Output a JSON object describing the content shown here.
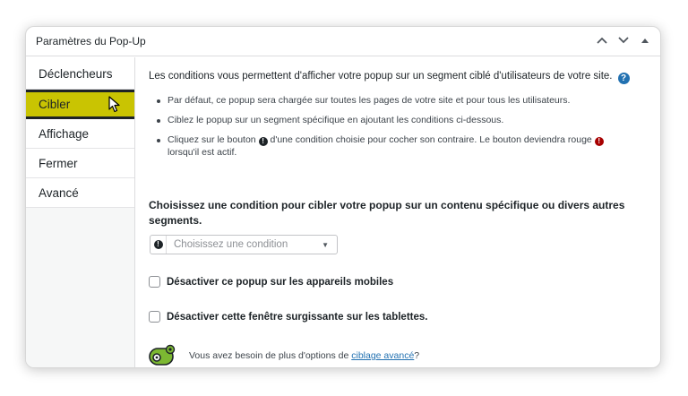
{
  "header": {
    "title": "Paramètres du Pop-Up"
  },
  "sidebar": {
    "items": [
      {
        "label": "Déclencheurs"
      },
      {
        "label": "Cibler"
      },
      {
        "label": "Affichage"
      },
      {
        "label": "Fermer"
      },
      {
        "label": "Avancé"
      }
    ],
    "active_index": 1
  },
  "main": {
    "intro": "Les conditions vous permettent d'afficher votre popup sur un segment ciblé d'utilisateurs de votre site.",
    "help_icon": "?",
    "bullets": {
      "b1": "Par défaut, ce popup sera chargée sur toutes les pages de votre site et pour tous les utilisateurs.",
      "b2": "Ciblez le popup sur un segment spécifique en ajoutant les conditions ci-dessous.",
      "b3_part1": "Cliquez sur le bouton",
      "b3_part2": "d'une condition choisie pour cocher son contraire. Le bouton deviendra rouge",
      "b3_part3": "lorsqu'il est actif."
    },
    "choose_title": "Choisissez une condition pour cibler votre popup sur un contenu spécifique ou divers autres segments.",
    "select_placeholder": "Choisissez une condition",
    "checkbox_mobile": "Désactiver ce popup sur les appareils mobiles",
    "checkbox_tablet": "Désactiver cette fenêtre surgissante sur les tablettes.",
    "advanced_prefix": "Vous avez besoin de plus d'options de",
    "advanced_link": "ciblage avancé",
    "advanced_suffix": " ?"
  },
  "icons": {
    "exclamation": "!",
    "select_arrow": "▼"
  },
  "colors": {
    "active_tab": "#c9c402",
    "link": "#2271b1",
    "negate_active": "#a70000",
    "plugin_icon": "#7cb832"
  }
}
